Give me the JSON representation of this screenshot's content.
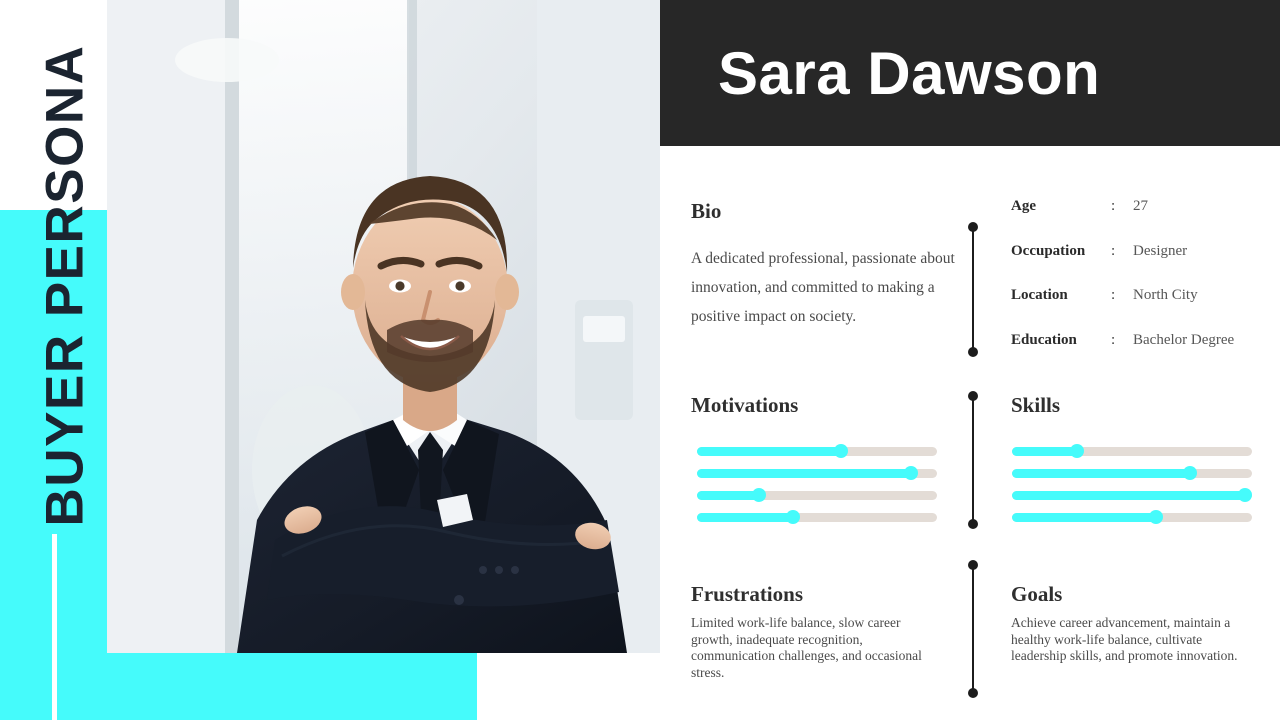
{
  "slide": {
    "vertical_title": "BUYER PERSONA",
    "accent_color": "#45FBFB",
    "header_color": "#272727",
    "track_color": "#E3DCD6"
  },
  "header": {
    "name": "Sara Dawson"
  },
  "photo": {
    "alt": "Smiling professional man in dark suit with arms crossed in a bright office"
  },
  "bio": {
    "heading": "Bio",
    "text": "A dedicated professional, passionate about innovation, and committed to making a positive impact on society."
  },
  "attributes": [
    {
      "label": "Age",
      "separator": ":",
      "value": "27"
    },
    {
      "label": "Occupation",
      "separator": ":",
      "value": "Designer"
    },
    {
      "label": "Location",
      "separator": ":",
      "value": "North City"
    },
    {
      "label": "Education",
      "separator": ":",
      "value": "Bachelor Degree"
    }
  ],
  "motivations": {
    "heading": "Motivations",
    "levels": [
      60,
      89,
      26,
      40
    ]
  },
  "skills": {
    "heading": "Skills",
    "levels": [
      27,
      74,
      97,
      60
    ]
  },
  "frustrations": {
    "heading": "Frustrations",
    "text": "Limited work-life balance, slow career growth, inadequate recognition, communication challenges, and occasional  stress."
  },
  "goals": {
    "heading": "Goals",
    "text": "Achieve career advancement, maintain a healthy work-life balance, cultivate leadership skills, and promote innovation."
  }
}
